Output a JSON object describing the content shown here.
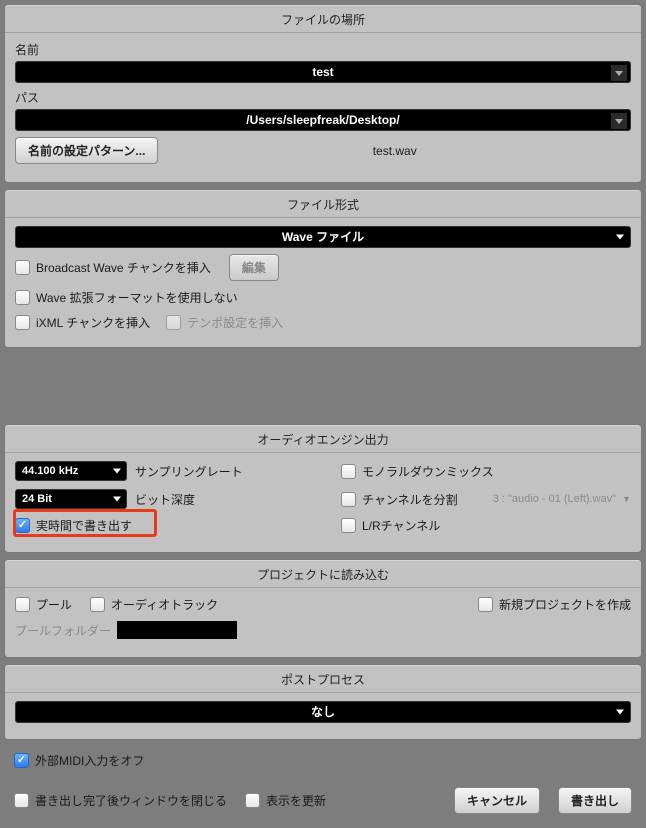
{
  "fileLocation": {
    "title": "ファイルの場所",
    "name_label": "名前",
    "name_value": "test",
    "path_label": "パス",
    "path_value": "/Users/sleepfreak/Desktop/",
    "pattern_button": "名前の設定パターン...",
    "filename_preview": "test.wav"
  },
  "fileFormat": {
    "title": "ファイル形式",
    "format_value": "Wave ファイル",
    "broadcast_cb": "Broadcast Wave チャンクを挿入",
    "edit_button": "編集",
    "wave_ext_cb": "Wave 拡張フォーマットを使用しない",
    "ixml_cb": "iXML チャンクを挿入",
    "tempo_cb": "テンポ設定を挿入"
  },
  "audioEngine": {
    "title": "オーディオエンジン出力",
    "sample_rate_value": "44.100 kHz",
    "sample_rate_label": "サンプリングレート",
    "bit_depth_value": "24 Bit",
    "bit_depth_label": "ビット深度",
    "realtime_cb": "実時間で書き出す",
    "mono_cb": "モノラルダウンミックス",
    "split_cb": "チャンネルを分割",
    "split_example": "3 : \"audio - 01 (Left).wav\"",
    "lr_cb": "L/Rチャンネル"
  },
  "importProject": {
    "title": "プロジェクトに読み込む",
    "pool_cb": "プール",
    "audio_track_cb": "オーディオトラック",
    "new_project_cb": "新規プロジェクトを作成",
    "pool_folder_label": "プールフォルダー"
  },
  "postProcess": {
    "title": "ポストプロセス",
    "value": "なし"
  },
  "footer": {
    "midi_off_cb": "外部MIDI入力をオフ",
    "close_after_cb": "書き出し完了後ウィンドウを閉じる",
    "refresh_cb": "表示を更新",
    "cancel_button": "キャンセル",
    "export_button": "書き出し"
  }
}
